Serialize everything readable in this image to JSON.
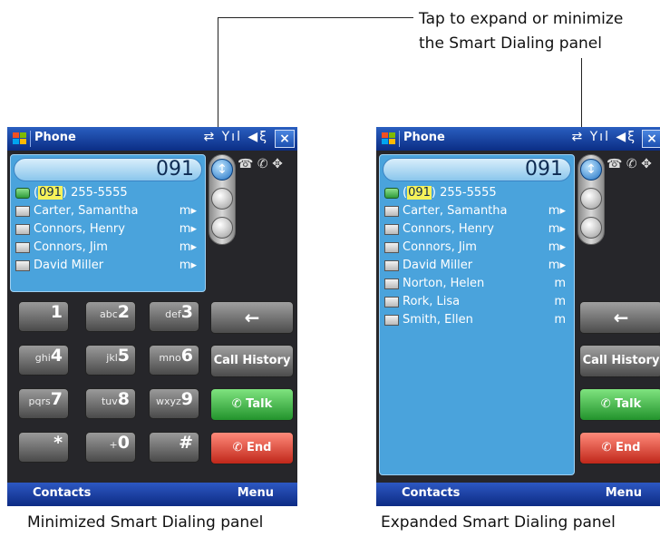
{
  "callout": {
    "line1": "Tap to expand or minimize",
    "line2": "the Smart Dialing panel"
  },
  "captions": {
    "left": "Minimized Smart Dialing panel",
    "right": "Expanded Smart Dialing panel"
  },
  "titlebar": {
    "app_title": "Phone",
    "close_label": "×",
    "status_icons": [
      "sync-icon",
      "signal-icon",
      "speaker-icon"
    ]
  },
  "dialed_number": "091",
  "match_prefix": "091",
  "match_rest": ") 255-5555",
  "match_open_paren": "(",
  "contacts_minimized": [
    {
      "name": "Carter, Samantha",
      "tag": "m▸"
    },
    {
      "name": "Connors, Henry",
      "tag": "m▸"
    },
    {
      "name": "Connors, Jim",
      "tag": "m▸"
    },
    {
      "name": "David Miller",
      "tag": "m▸"
    }
  ],
  "contacts_expanded": [
    {
      "name": "Carter, Samantha",
      "tag": "m▸"
    },
    {
      "name": "Connors, Henry",
      "tag": "m▸"
    },
    {
      "name": "Connors, Jim",
      "tag": "m▸"
    },
    {
      "name": "David Miller",
      "tag": "m▸"
    },
    {
      "name": "Norton, Helen",
      "tag": "m"
    },
    {
      "name": "Rork, Lisa",
      "tag": "m"
    },
    {
      "name": "Smith, Ellen",
      "tag": "m"
    }
  ],
  "keypad": [
    {
      "sub": "",
      "main": "1"
    },
    {
      "sub": "abc",
      "main": "2"
    },
    {
      "sub": "def",
      "main": "3"
    },
    {
      "sub": "ghi",
      "main": "4"
    },
    {
      "sub": "jkl",
      "main": "5"
    },
    {
      "sub": "mno",
      "main": "6"
    },
    {
      "sub": "pqrs",
      "main": "7"
    },
    {
      "sub": "tuv",
      "main": "8"
    },
    {
      "sub": "wxyz",
      "main": "9"
    },
    {
      "sub": "",
      "main": "*"
    },
    {
      "sub": "+",
      "main": "0"
    },
    {
      "sub": "",
      "main": "#"
    }
  ],
  "buttons": {
    "backspace": "←",
    "call_history": "Call History",
    "talk": "Talk",
    "end": "End"
  },
  "softkeys": {
    "left": "Contacts",
    "right": "Menu"
  },
  "colors": {
    "panel": "#4aa3dc",
    "titlebar": "#1b44a8",
    "talk": "#2fa83a",
    "end": "#d33a2a",
    "highlight": "#f6f25a"
  }
}
